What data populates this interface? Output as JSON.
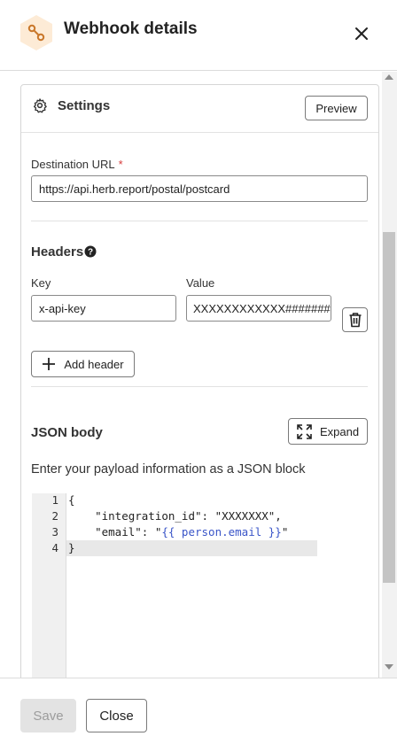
{
  "header": {
    "title": "Webhook details",
    "icon": "webhook-hexagon-icon",
    "accent": "#c9772a",
    "hex_bg": "#fdebd6"
  },
  "settings": {
    "title": "Settings",
    "preview_label": "Preview",
    "destination": {
      "label": "Destination URL",
      "required_mark": "*",
      "value": "https://api.herb.report/postal/postcard"
    },
    "headers": {
      "title": "Headers",
      "key_label": "Key",
      "value_label": "Value",
      "rows": [
        {
          "key": "x-api-key",
          "value": "XXXXXXXXXXXX#######"
        }
      ],
      "add_label": "Add header"
    },
    "json_body": {
      "title": "JSON body",
      "expand_label": "Expand",
      "description": "Enter your payload information as a JSON block",
      "line_numbers": [
        "1",
        "2",
        "3",
        "4"
      ],
      "lines": {
        "l1": "{",
        "l2": "    \"integration_id\": \"XXXXXXX\",",
        "l3_prefix": "    \"email\": \"",
        "l3_template": "{{ person.email }}",
        "l3_suffix": "\"",
        "l4": "}"
      },
      "active_line": 4
    }
  },
  "footer": {
    "save_label": "Save",
    "close_label": "Close"
  }
}
